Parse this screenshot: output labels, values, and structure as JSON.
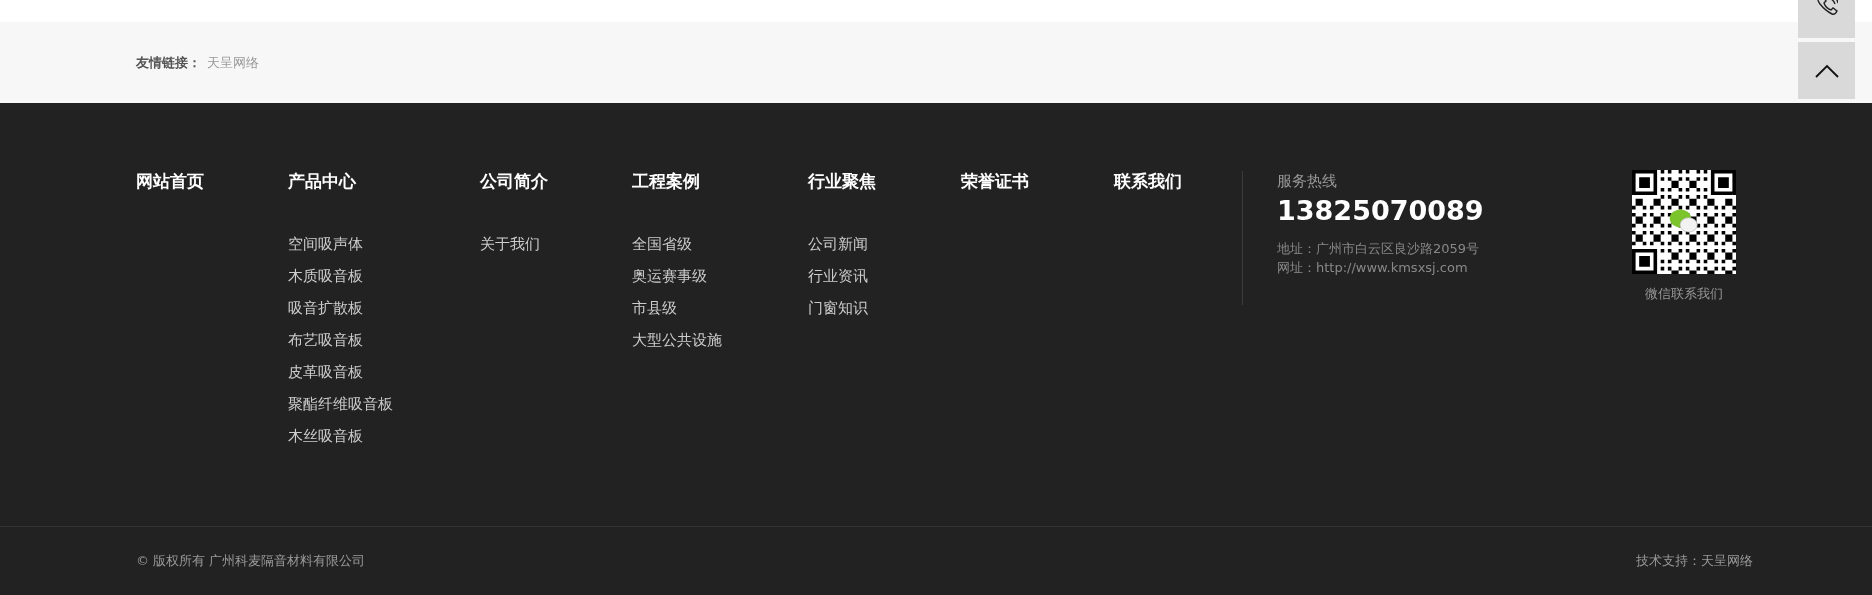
{
  "friend_links": {
    "label": "友情链接：",
    "links": [
      "天呈网络"
    ]
  },
  "nav_columns": [
    {
      "heading": "网站首页"
    },
    {
      "heading": "产品中心",
      "items": [
        "空间吸声体",
        "木质吸音板",
        "吸音扩散板",
        "布艺吸音板",
        "皮革吸音板",
        "聚酯纤维吸音板",
        "木丝吸音板"
      ]
    },
    {
      "heading": "公司简介",
      "items": [
        "关于我们"
      ]
    },
    {
      "heading": "工程案例",
      "items": [
        "全国省级",
        "奥运赛事级",
        "市县级",
        "大型公共设施"
      ]
    },
    {
      "heading": "行业聚焦",
      "items": [
        "公司新闻",
        "行业资讯",
        "门窗知识"
      ]
    },
    {
      "heading": "荣誉证书"
    },
    {
      "heading": "联系我们"
    }
  ],
  "contact": {
    "hotline_label": "服务热线",
    "phone": "13825070089",
    "address": "地址：广州市白云区良沙路2059号",
    "website": "网址：http://www.kmsxsj.com"
  },
  "qr": {
    "caption": "微信联系我们"
  },
  "bottom_bar": {
    "copyright": "© 版权所有 广州科麦隔音材料有限公司",
    "support": "技术支持：天呈网络"
  }
}
